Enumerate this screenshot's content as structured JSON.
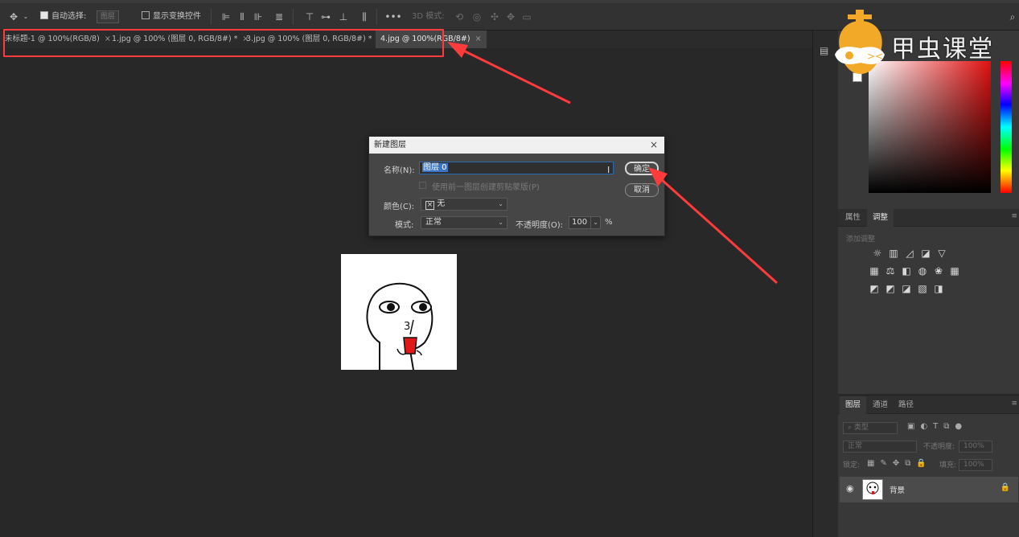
{
  "options_bar": {
    "auto_select_label": "自动选择:",
    "auto_select_target": "图层",
    "show_transform_label": "显示变换控件",
    "mode_3d_label": "3D 模式:",
    "more": "•••"
  },
  "tabs": [
    {
      "label": "未标题-1 @ 100%(RGB/8)",
      "close": "×",
      "active": false
    },
    {
      "label": "1.jpg @ 100% (图层 0, RGB/8#) *",
      "close": "×",
      "active": false
    },
    {
      "label": "3.jpg @ 100% (图层 0, RGB/8#) *",
      "close": "×",
      "active": false
    },
    {
      "label": "4.jpg @ 100%(RGB/8#)",
      "close": "×",
      "active": true
    }
  ],
  "dialog": {
    "title": "新建图层",
    "close": "×",
    "name_label": "名称(N):",
    "name_value": "图层 0",
    "clip_mask_label": "使用前一图层创建剪贴蒙版(P)",
    "color_label": "颜色(C):",
    "color_value": "无",
    "mode_label": "模式:",
    "mode_value": "正常",
    "opacity_label": "不透明度(O):",
    "opacity_value": "100",
    "opacity_unit": "%",
    "ok_label": "确定",
    "cancel_label": "取消"
  },
  "watermark": {
    "text": "甲虫课堂"
  },
  "adjustments_panel": {
    "tab_properties": "属性",
    "tab_adjustments": "调整",
    "hint": "添加调整"
  },
  "layers_panel": {
    "tab_layers": "图层",
    "tab_channels": "通道",
    "tab_paths": "路径",
    "filter_kind": "类型",
    "blend_mode": "正常",
    "opacity_label": "不透明度:",
    "opacity_value": "100%",
    "lock_label": "锁定:",
    "fill_label": "填充:",
    "fill_value": "100%",
    "layer_name": "背景"
  },
  "colors": {
    "accent_red": "#ff3b3b",
    "selection_blue": "#3a74c4"
  }
}
